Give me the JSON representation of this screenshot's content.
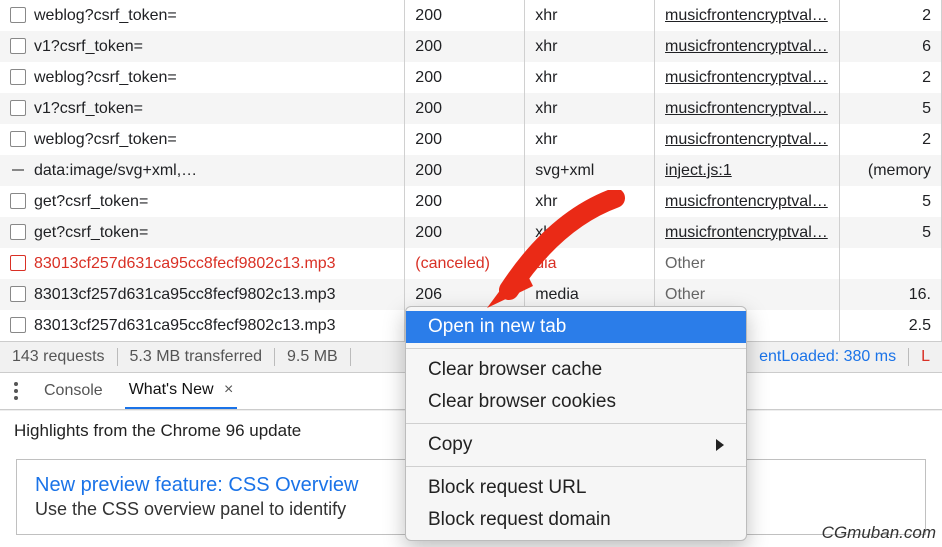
{
  "rows": [
    {
      "name": "weblog?csrf_token=",
      "status": "200",
      "type": "xhr",
      "initiator": "musicfrontencryptval…",
      "size": "2",
      "icon": "checkbox",
      "text_class": ""
    },
    {
      "name": "v1?csrf_token=",
      "status": "200",
      "type": "xhr",
      "initiator": "musicfrontencryptval…",
      "size": "6",
      "icon": "checkbox",
      "text_class": ""
    },
    {
      "name": "weblog?csrf_token=",
      "status": "200",
      "type": "xhr",
      "initiator": "musicfrontencryptval…",
      "size": "2",
      "icon": "checkbox",
      "text_class": ""
    },
    {
      "name": "v1?csrf_token=",
      "status": "200",
      "type": "xhr",
      "initiator": "musicfrontencryptval…",
      "size": "5",
      "icon": "checkbox",
      "text_class": ""
    },
    {
      "name": "weblog?csrf_token=",
      "status": "200",
      "type": "xhr",
      "initiator": "musicfrontencryptval…",
      "size": "2",
      "icon": "checkbox",
      "text_class": ""
    },
    {
      "name": "data:image/svg+xml,…",
      "status": "200",
      "type": "svg+xml",
      "initiator": "inject.js:1",
      "size": "(memory",
      "icon": "dash",
      "text_class": ""
    },
    {
      "name": "get?csrf_token=",
      "status": "200",
      "type": "xhr",
      "initiator": "musicfrontencryptval…",
      "size": "5",
      "icon": "checkbox",
      "text_class": ""
    },
    {
      "name": "get?csrf_token=",
      "status": "200",
      "type": "xhr",
      "initiator": "musicfrontencryptval…",
      "size": "5",
      "icon": "checkbox",
      "text_class": ""
    },
    {
      "name": "83013cf257d631ca95cc8fecf9802c13.mp3",
      "status": "(canceled)",
      "type": "dia",
      "initiator": "Other",
      "size": "",
      "icon": "checkbox-red",
      "text_class": "red-text"
    },
    {
      "name": "83013cf257d631ca95cc8fecf9802c13.mp3",
      "status": "206",
      "type": "media",
      "initiator": "Other",
      "size": "16.",
      "icon": "checkbox",
      "text_class": ""
    },
    {
      "name": "83013cf257d631ca95cc8fecf9802c13.mp3",
      "status": "",
      "type": "",
      "initiator": "",
      "size": "2.5",
      "icon": "checkbox",
      "text_class": ""
    }
  ],
  "status": {
    "requests": "143 requests",
    "transferred": "5.3 MB transferred",
    "resources": "9.5 MB",
    "dcl_label": "entLoaded: 380 ms",
    "load": "L"
  },
  "tabs": {
    "console": "Console",
    "whats_new": "What's New",
    "close": "×"
  },
  "highlights": "Highlights from the Chrome 96 update",
  "feature": {
    "headline": "New preview feature: CSS Overview",
    "sub": "Use the CSS overview panel to identify"
  },
  "context_menu": {
    "open": "Open in new tab",
    "clear_cache": "Clear browser cache",
    "clear_cookies": "Clear browser cookies",
    "copy": "Copy",
    "block_url": "Block request URL",
    "block_domain": "Block request domain"
  },
  "watermark": "CGmuban.com"
}
